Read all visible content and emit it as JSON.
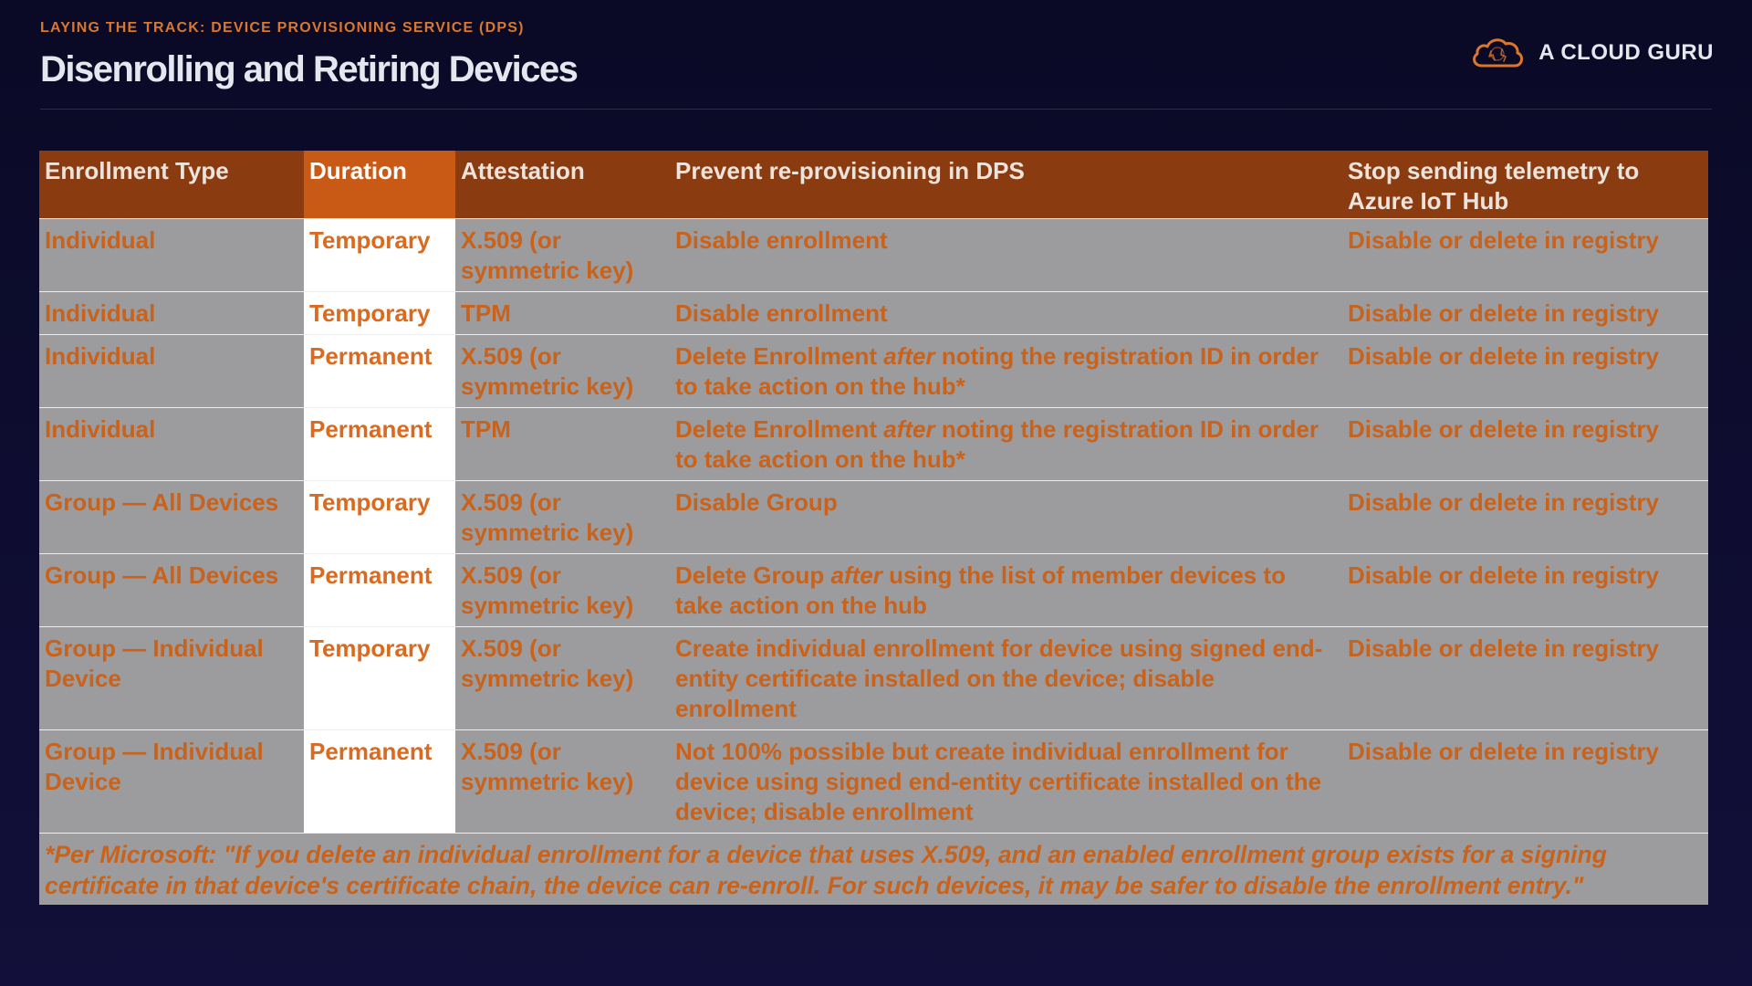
{
  "header": {
    "eyebrow": "LAYING THE TRACK: DEVICE PROVISIONING SERVICE (DPS)",
    "title": "Disenrolling and Retiring Devices"
  },
  "logo": {
    "icon": "cloud-logo-icon",
    "text": "A CLOUD GURU"
  },
  "table": {
    "columns": [
      "Enrollment Type",
      "Duration",
      "Attestation",
      "Prevent re-provisioning in DPS",
      "Stop sending telemetry to Azure IoT Hub"
    ],
    "rows": [
      {
        "enrollment": "Individual",
        "duration": "Temporary",
        "attestation": "X.509 (or symmetric key)",
        "prevent": {
          "before": "Disable enrollment",
          "emph": "",
          "after": ""
        },
        "stop": "Disable or delete in registry"
      },
      {
        "enrollment": "Individual",
        "duration": "Temporary",
        "attestation": "TPM",
        "prevent": {
          "before": "Disable enrollment",
          "emph": "",
          "after": ""
        },
        "stop": "Disable or delete in registry"
      },
      {
        "enrollment": "Individual",
        "duration": "Permanent",
        "attestation": "X.509 (or symmetric key)",
        "prevent": {
          "before": "Delete Enrollment ",
          "emph": "after",
          "after": " noting the registration ID in order to take action on the hub*"
        },
        "stop": "Disable or delete in registry"
      },
      {
        "enrollment": "Individual",
        "duration": "Permanent",
        "attestation": "TPM",
        "prevent": {
          "before": "Delete Enrollment ",
          "emph": "after",
          "after": " noting the registration ID in order to take action on the hub*"
        },
        "stop": "Disable or delete in registry"
      },
      {
        "enrollment": "Group — All Devices",
        "duration": "Temporary",
        "attestation": "X.509 (or symmetric key)",
        "prevent": {
          "before": "Disable Group",
          "emph": "",
          "after": ""
        },
        "stop": "Disable or delete in registry"
      },
      {
        "enrollment": "Group — All Devices",
        "duration": "Permanent",
        "attestation": "X.509 (or symmetric key)",
        "prevent": {
          "before": "Delete Group ",
          "emph": "after",
          "after": " using the list of member devices to take action on the hub"
        },
        "stop": "Disable or delete in registry"
      },
      {
        "enrollment": "Group — Individual Device",
        "duration": "Temporary",
        "attestation": "X.509 (or symmetric key)",
        "prevent": {
          "before": "Create individual enrollment for device using signed end-entity certificate installed on the device; disable enrollment",
          "emph": "",
          "after": ""
        },
        "stop": "Disable or delete in registry"
      },
      {
        "enrollment": "Group — Individual Device",
        "duration": "Permanent",
        "attestation": "X.509 (or symmetric key)",
        "prevent": {
          "before": "Not 100% possible but create individual enrollment for device using signed end-entity certificate installed on the device; disable enrollment",
          "emph": "",
          "after": ""
        },
        "stop": "Disable or delete in registry"
      }
    ],
    "footnote": "*Per Microsoft: \"If you delete an individual enrollment for a device that uses X.509, and an enabled enrollment group exists for a signing certificate in that device's certificate chain, the device can re-enroll. For such devices, it may be safer to disable the enrollment entry.\""
  },
  "colors": {
    "background": "#0a0a26",
    "header_row": "#8a3b10",
    "duration_header": "#c85a16",
    "cell": "#9c9c9f",
    "duration_cell": "#ffffff",
    "text_accent": "#c9621b",
    "eyebrow": "#d9772f",
    "title": "#e6e6ee"
  }
}
